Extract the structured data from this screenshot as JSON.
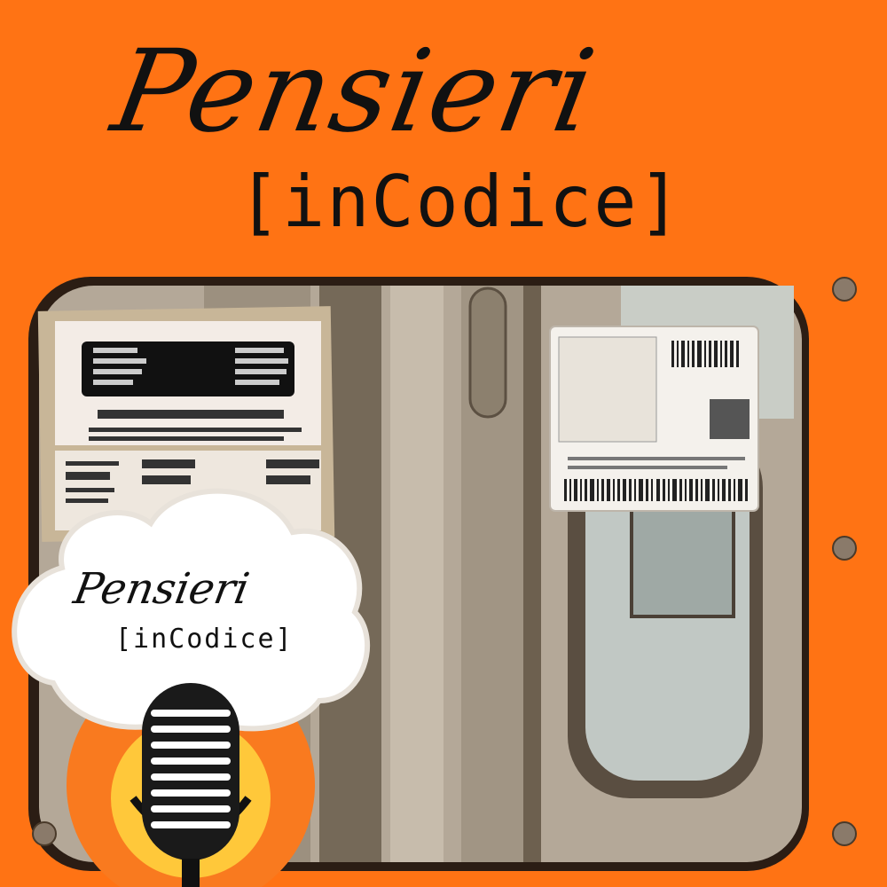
{
  "title": {
    "main": "Pensieri",
    "sub": "[inCodice]"
  },
  "logo": {
    "main": "Pensieri",
    "sub": "[inCodice]"
  },
  "colors": {
    "background": "#ff7314",
    "train_door": "#a89e90",
    "window_glass": "#bfc7c4",
    "mic_yellow": "#ffc83a",
    "text": "#111111"
  },
  "icons": [
    "microphone-icon",
    "cloud-shape",
    "barcode-icon",
    "qr-code-icon"
  ]
}
